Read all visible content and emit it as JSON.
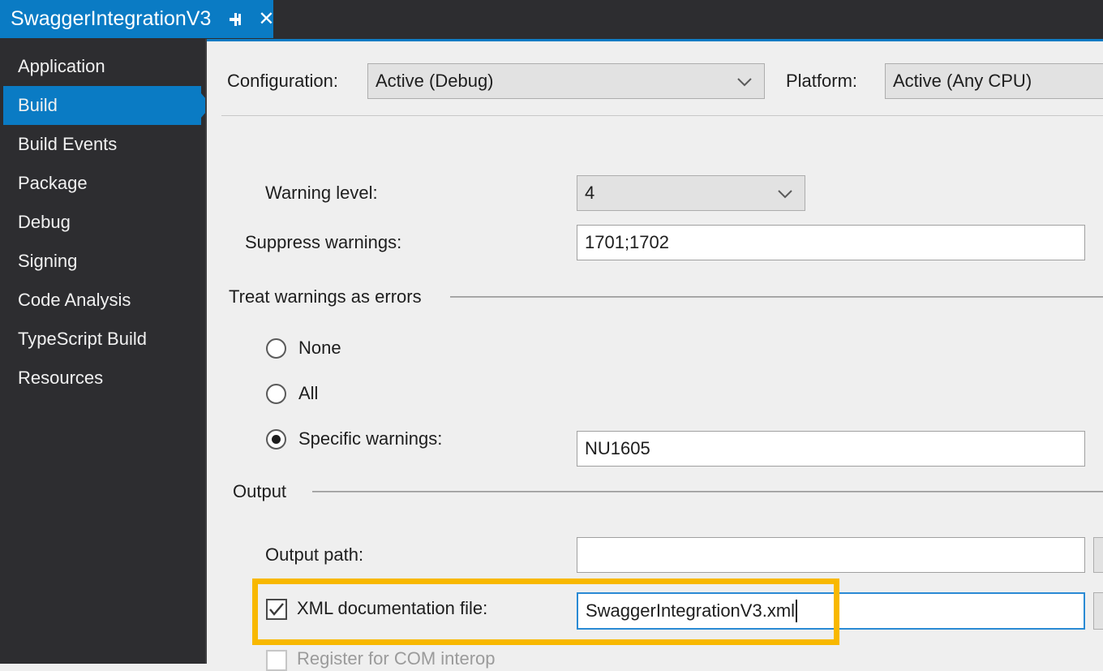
{
  "window": {
    "tab_title": "SwaggerIntegrationV3",
    "pin_icon": "pin-icon",
    "close_icon": "close-icon",
    "accent_color": "#0a7bc4",
    "highlight_color": "#f8b800"
  },
  "sidebar": {
    "items": [
      {
        "label": "Application",
        "selected": false
      },
      {
        "label": "Build",
        "selected": true
      },
      {
        "label": "Build Events",
        "selected": false
      },
      {
        "label": "Package",
        "selected": false
      },
      {
        "label": "Debug",
        "selected": false
      },
      {
        "label": "Signing",
        "selected": false
      },
      {
        "label": "Code Analysis",
        "selected": false
      },
      {
        "label": "TypeScript Build",
        "selected": false
      },
      {
        "label": "Resources",
        "selected": false
      }
    ]
  },
  "topbar": {
    "configuration_label": "Configuration:",
    "configuration_value": "Active (Debug)",
    "platform_label": "Platform:",
    "platform_value": "Active (Any CPU)",
    "dropdown_icon": "chevron-down-icon"
  },
  "general": {
    "warning_level_label": "Warning level:",
    "warning_level_value": "4",
    "suppress_warnings_label": "Suppress warnings:",
    "suppress_warnings_value": "1701;1702"
  },
  "treat_warnings": {
    "group_label": "Treat warnings as errors",
    "options": [
      {
        "label": "None",
        "selected": false
      },
      {
        "label": "All",
        "selected": false
      },
      {
        "label": "Specific warnings:",
        "selected": true
      }
    ],
    "specific_warnings_value": "NU1605"
  },
  "output": {
    "group_label": "Output",
    "output_path_label": "Output path:",
    "output_path_value": "",
    "xml_doc_label": "XML documentation file:",
    "xml_doc_value": "SwaggerIntegrationV3.xml",
    "xml_doc_checked": true,
    "com_interop_label": "Register for COM interop",
    "com_interop_checked": false,
    "browse_button_label": "...",
    "check_icon": "check-icon"
  }
}
